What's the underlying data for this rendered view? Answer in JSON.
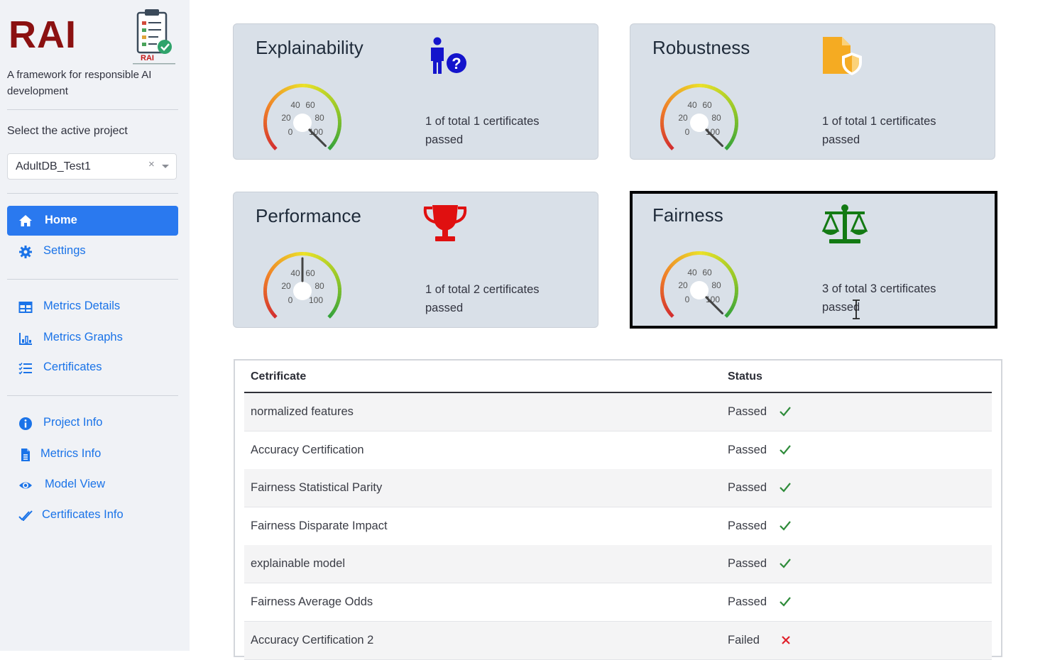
{
  "sidebar": {
    "brand": "RAI",
    "logo_text": "RAI",
    "tagline": "A framework for responsible AI development",
    "select_label": "Select the active project",
    "select_value": "AdultDB_Test1",
    "select_clear": "×",
    "nav": [
      {
        "label": "Home",
        "icon": "home-icon",
        "active": true
      },
      {
        "label": "Settings",
        "icon": "gear-icon"
      },
      {
        "label": "Metrics Details",
        "icon": "table-icon"
      },
      {
        "label": "Metrics Graphs",
        "icon": "chart-icon"
      },
      {
        "label": "Certificates",
        "icon": "list-check-icon"
      },
      {
        "label": "Project Info",
        "icon": "info-icon"
      },
      {
        "label": "Metrics Info",
        "icon": "document-icon"
      },
      {
        "label": "Model View",
        "icon": "eye-icon"
      },
      {
        "label": "Certificates Info",
        "icon": "double-check-icon"
      }
    ]
  },
  "cards": [
    {
      "title": "Explainability",
      "icon": "person-question-icon",
      "icon_color": "#1414cc",
      "line1": "1 of total 1 certificates",
      "line2": "passed",
      "ticks": [
        "0",
        "20",
        "40",
        "60",
        "80",
        "100"
      ],
      "value": 1.0
    },
    {
      "title": "Robustness",
      "icon": "file-shield-icon",
      "icon_color": "#f5ab22",
      "line1": "1 of total 1 certificates",
      "line2": "passed",
      "ticks": [
        "0",
        "20",
        "40",
        "60",
        "80",
        "100"
      ],
      "value": 1.0
    },
    {
      "title": "Performance",
      "icon": "trophy-icon",
      "icon_color": "#e01010",
      "line1": "1 of total 2 certificates",
      "line2": "passed",
      "ticks": [
        "0",
        "20",
        "40",
        "60",
        "80",
        "100"
      ],
      "value": 0.5
    },
    {
      "title": "Fairness",
      "icon": "scale-icon",
      "icon_color": "#137a13",
      "line1": "3 of total 3 certificates",
      "line2": "passed",
      "ticks": [
        "0",
        "20",
        "40",
        "60",
        "80",
        "100"
      ],
      "value": 1.0
    }
  ],
  "table": {
    "headers": [
      "Cetrificate",
      "Status"
    ],
    "rows": [
      {
        "name": "normalized features",
        "status": "Passed",
        "mark": "check"
      },
      {
        "name": "Accuracy Certification",
        "status": "Passed",
        "mark": "check"
      },
      {
        "name": "Fairness Statistical Parity",
        "status": "Passed",
        "mark": "check"
      },
      {
        "name": "Fairness Disparate Impact",
        "status": "Passed",
        "mark": "check"
      },
      {
        "name": "explainable model",
        "status": "Passed",
        "mark": "check"
      },
      {
        "name": "Fairness Average Odds",
        "status": "Passed",
        "mark": "check"
      },
      {
        "name": "Accuracy Certification 2",
        "status": "Failed",
        "mark": "cross"
      }
    ]
  },
  "colors": {
    "accent": "#2a79ef",
    "link": "#1a73e8",
    "brand": "#8b1111",
    "pass": "#2e8b3a",
    "fail": "#e0202a"
  }
}
